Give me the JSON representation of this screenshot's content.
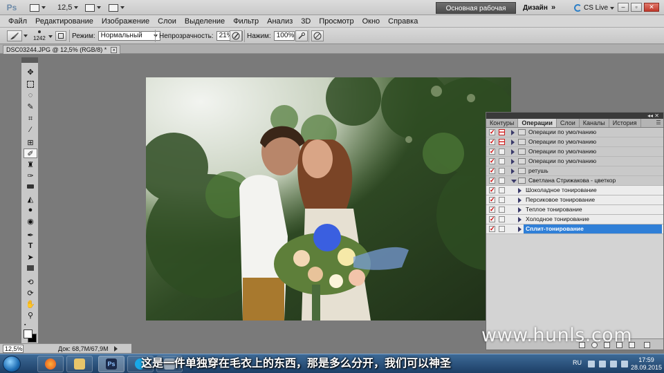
{
  "app": {
    "logo": "Ps",
    "zoom": "12,5",
    "workspace": "Основная рабочая среда",
    "design": "Дизайн",
    "more": "»",
    "cslive": "CS Live"
  },
  "menu": [
    "Файл",
    "Редактирование",
    "Изображение",
    "Слои",
    "Выделение",
    "Фильтр",
    "Анализ",
    "3D",
    "Просмотр",
    "Окно",
    "Справка"
  ],
  "options": {
    "brush_size": "1242",
    "mode_label": "Режим:",
    "mode_value": "Нормальный",
    "opacity_label": "Непрозрачность:",
    "opacity_value": "21%",
    "flow_label": "Нажим:",
    "flow_value": "100%"
  },
  "document": {
    "tab_title": "DSC03244.JPG @ 12,5% (RGB/8) *",
    "close": "×"
  },
  "status": {
    "zoom": "12,5%",
    "doc_info": "Док: 68,7M/67,9M"
  },
  "panel": {
    "tabs": [
      "Контуры",
      "Операции",
      "Слои",
      "Каналы",
      "История"
    ],
    "active_tab": 1,
    "actions": [
      {
        "label": "Операции по умолчанию",
        "level": 0,
        "checked": true,
        "dialog": "red",
        "open": false
      },
      {
        "label": "Операции по умолчанию",
        "level": 0,
        "checked": true,
        "dialog": "red",
        "open": false
      },
      {
        "label": "Операции по умолчанию",
        "level": 0,
        "checked": true,
        "dialog": "",
        "open": false
      },
      {
        "label": "Операции по умолчанию",
        "level": 0,
        "checked": true,
        "dialog": "",
        "open": false
      },
      {
        "label": "ретушь",
        "level": 0,
        "checked": true,
        "dialog": "",
        "open": false
      },
      {
        "label": "Светлана Стрижакова - цветкор",
        "level": 0,
        "checked": true,
        "dialog": "",
        "open": true
      },
      {
        "label": "Шоколадное тонирование",
        "level": 1,
        "checked": true,
        "dialog": ""
      },
      {
        "label": "Персиковое тонирование",
        "level": 1,
        "checked": true,
        "dialog": ""
      },
      {
        "label": "Теплое тонирование",
        "level": 1,
        "checked": true,
        "dialog": ""
      },
      {
        "label": "Холодное тонирование",
        "level": 1,
        "checked": true,
        "dialog": ""
      },
      {
        "label": "Сплит-тонирование",
        "level": 1,
        "checked": true,
        "dialog": "",
        "selected": true
      }
    ]
  },
  "watermark": "www.hunls.com",
  "subtitle": "这是一件单独穿在毛衣上的东西，那是多么分开，我们可以神圣",
  "taskbar": {
    "lang": "RU",
    "time": "17:59",
    "date": "28.09.2015"
  },
  "colors": {
    "selection": "#2f7fd7",
    "checkmark": "#d10000",
    "workspace_button": "#5a5a5a"
  }
}
